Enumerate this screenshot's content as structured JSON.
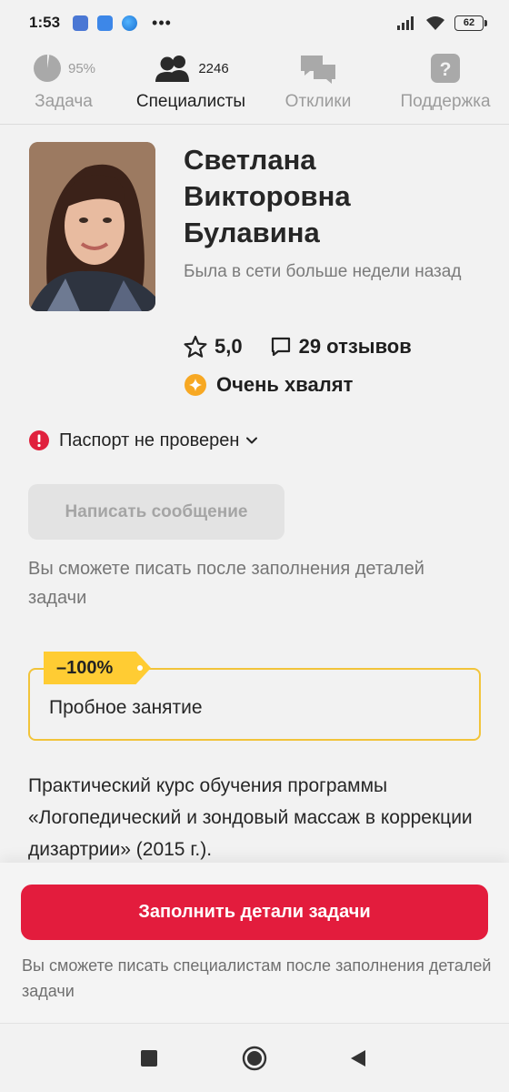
{
  "status_bar": {
    "time": "1:53",
    "dots": "•••",
    "battery": "62"
  },
  "tabs": [
    {
      "label": "Задача",
      "count": "95%",
      "icon": "pie-chart-icon",
      "active": false
    },
    {
      "label": "Специалисты",
      "count": "2246",
      "icon": "users-icon",
      "active": true
    },
    {
      "label": "Отклики",
      "icon": "chat-bubbles-icon",
      "active": false
    },
    {
      "label": "Поддержка",
      "icon": "question-icon",
      "active": false
    }
  ],
  "profile": {
    "name": "Светлана Викторовна Булавина",
    "last_seen": "Была в сети больше недели назад",
    "rating": "5,0",
    "reviews": "29 отзывов",
    "praise": "Очень хвалят",
    "passport_status": "Паспорт не проверен"
  },
  "message": {
    "button_label": "Написать сообщение",
    "hint": "Вы сможете писать после заполнения деталей задачи"
  },
  "offer": {
    "badge": "–100%",
    "title": "Пробное занятие"
  },
  "description": "Практический курс обучения программы «Логопедический и зондовый массаж в коррекции дизартрии» (2015 г.).",
  "bottom": {
    "button_label": "Заполнить детали задачи",
    "hint": "Вы сможете писать специалистам после заполнения деталей задачи"
  },
  "colors": {
    "accent_red": "#e31c3d",
    "badge_yellow": "#ffcc33",
    "praise_orange": "#f7a823",
    "warning_red": "#e0213d"
  }
}
